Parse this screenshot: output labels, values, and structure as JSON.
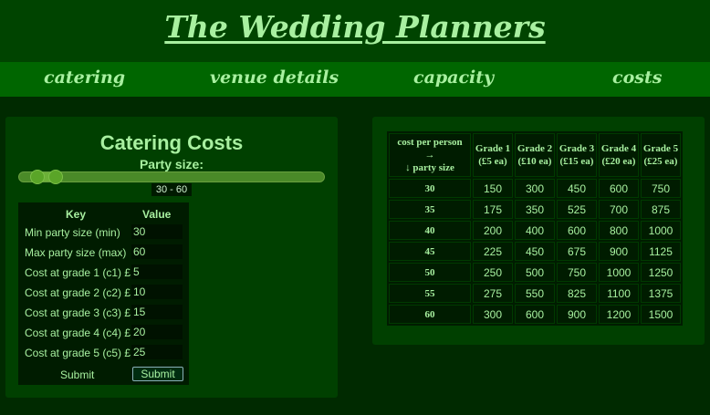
{
  "site": {
    "title": "The Wedding Planners"
  },
  "nav": [
    "catering",
    "venue details",
    "capacity",
    "costs"
  ],
  "catering": {
    "title": "Catering Costs",
    "party_label": "Party size:",
    "slider": {
      "readout": "30 - 60",
      "min_value": 30,
      "max_value": 60
    },
    "form": {
      "key_header": "Key",
      "value_header": "Value",
      "rows": [
        {
          "label": "Min party size (min)",
          "value": "30"
        },
        {
          "label": "Max party size (max)",
          "value": "60"
        },
        {
          "label": "Cost at grade 1 (c1) £",
          "value": "5"
        },
        {
          "label": "Cost at grade 2 (c2) £",
          "value": "10"
        },
        {
          "label": "Cost at grade 3 (c3) £",
          "value": "15"
        },
        {
          "label": "Cost at grade 4 (c4) £",
          "value": "20"
        },
        {
          "label": "Cost at grade 5 (c5) £",
          "value": "25"
        }
      ],
      "submit_label": "Submit",
      "submit_button": "Submit"
    }
  },
  "table": {
    "corner": {
      "line1": "cost per person",
      "line2": "→",
      "line3": "↓ party size"
    },
    "grades": [
      {
        "name": "Grade 1",
        "price": "(£5 ea)"
      },
      {
        "name": "Grade 2",
        "price": "(£10 ea)"
      },
      {
        "name": "Grade 3",
        "price": "(£15 ea)"
      },
      {
        "name": "Grade 4",
        "price": "(£20 ea)"
      },
      {
        "name": "Grade 5",
        "price": "(£25 ea)"
      }
    ],
    "rows": [
      {
        "size": "30",
        "values": [
          "150",
          "300",
          "450",
          "600",
          "750"
        ]
      },
      {
        "size": "35",
        "values": [
          "175",
          "350",
          "525",
          "700",
          "875"
        ]
      },
      {
        "size": "40",
        "values": [
          "200",
          "400",
          "600",
          "800",
          "1000"
        ]
      },
      {
        "size": "45",
        "values": [
          "225",
          "450",
          "675",
          "900",
          "1125"
        ]
      },
      {
        "size": "50",
        "values": [
          "250",
          "500",
          "750",
          "1000",
          "1250"
        ]
      },
      {
        "size": "55",
        "values": [
          "275",
          "550",
          "825",
          "1100",
          "1375"
        ]
      },
      {
        "size": "60",
        "values": [
          "300",
          "600",
          "900",
          "1200",
          "1500"
        ]
      }
    ]
  },
  "colors": {
    "background": "#002a00",
    "header": "#004400",
    "nav": "#006600",
    "text": "#a8f0a0"
  }
}
